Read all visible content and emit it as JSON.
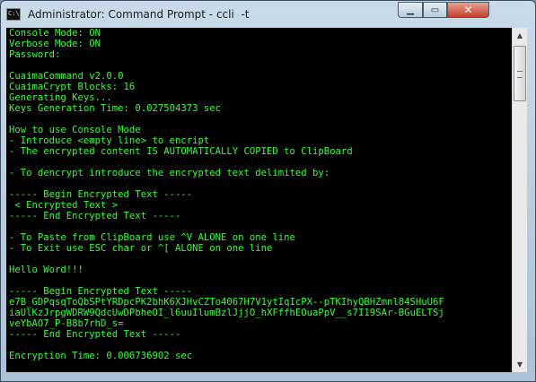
{
  "window": {
    "icon_text": "C:\\",
    "title": "Administrator: Command Prompt - ccli  -t",
    "controls": {
      "minimize": "▁",
      "maximize": "▭",
      "close": "✕"
    }
  },
  "console": {
    "lines": [
      "Console Mode: ON",
      "Verbose Mode: ON",
      "Password:",
      "",
      "CuaimaCommand v2.0.0",
      "CuaimaCrypt Blocks: 16",
      "Generating Keys...",
      "Keys Generation Time: 0.027504373 sec",
      "",
      "How to use Console Mode",
      "- Introduce <empty line> to encript",
      "- The encrypted content IS AUTOMATICALLY COPIED to ClipBoard",
      "",
      "- To dencrypt introduce the encrypted text delimited by:",
      "",
      "----- Begin Encrypted Text -----",
      " < Encrypted Text >",
      "----- End Encrypted Text -----",
      "",
      "- To Paste from ClipBoard use ^V ALONE on one line",
      "- To Exit use ESC char or ^[ ALONE on one line",
      "",
      "Hello Word!!!",
      "",
      "----- Begin Encrypted Text -----",
      "e7B_GDPqsqToQbSPtYRDpcPK2bhK6XJHvCZTo4067H7V1ytIqIcPX--pTKIhyQBHZmnl84SHuU6F",
      "iaUlKzJrpgWDRW9QdcUwDPbheOI_l6uuIlumBzlJjjO_hXFffhEOuaPpV__s7I19SAr-BGuELTSj",
      "veYbAO7_P-B8b7rhD_s=",
      "----- End Encrypted Text -----",
      "",
      "Encryption Time: 0.006736902 sec",
      ""
    ]
  },
  "scrollbar": {
    "up": "▲",
    "down": "▼"
  }
}
